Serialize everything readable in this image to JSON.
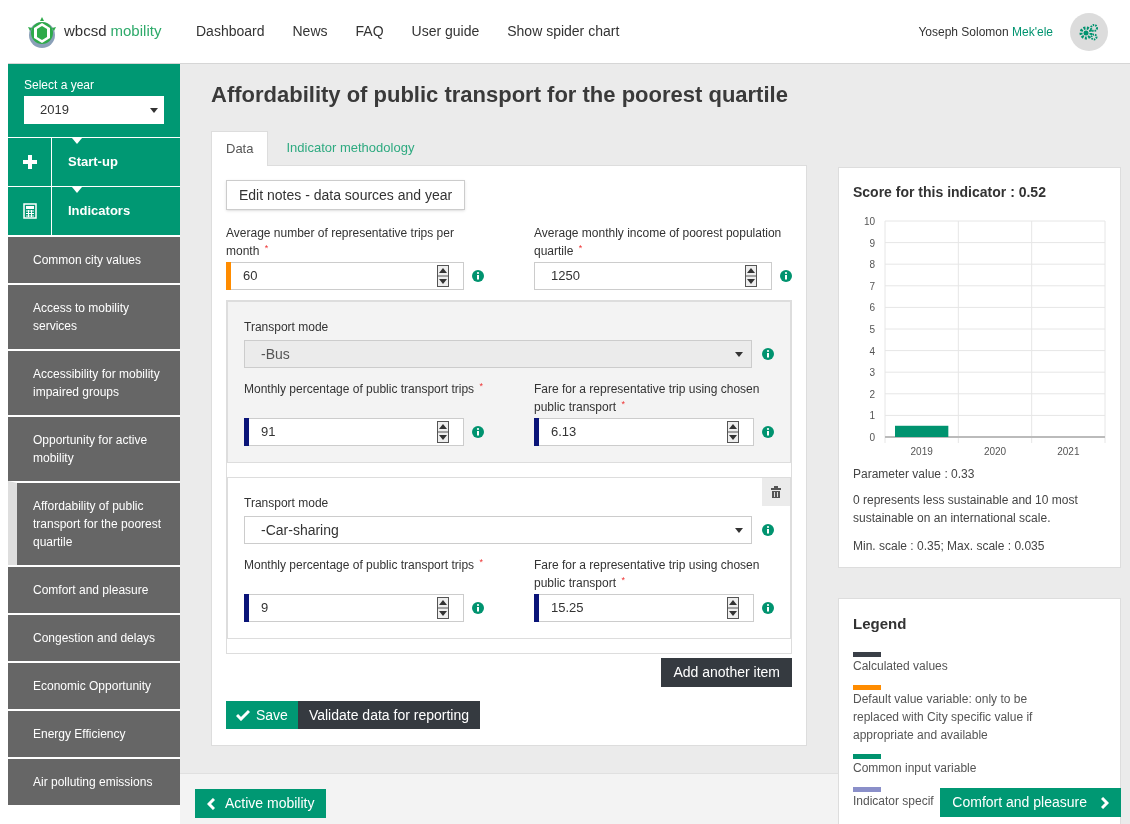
{
  "header": {
    "logo": {
      "brand": "wbcsd",
      "product": "mobility"
    },
    "nav": [
      {
        "label": "Dashboard"
      },
      {
        "label": "News"
      },
      {
        "label": "FAQ"
      },
      {
        "label": "User guide"
      },
      {
        "label": "Show spider chart"
      }
    ],
    "user": {
      "name": "Yoseph Solomon",
      "city": "Mek'ele"
    }
  },
  "sidebar": {
    "year_label": "Select a year",
    "year": "2019",
    "sections": [
      {
        "kind": "plus",
        "label": "Start-up"
      },
      {
        "kind": "calculator",
        "label": "Indicators"
      }
    ],
    "items": [
      {
        "label": "Common city values",
        "selected": false
      },
      {
        "label": "Access to mobility services",
        "selected": false
      },
      {
        "label": "Accessibility for mobility impaired groups",
        "selected": false
      },
      {
        "label": "Opportunity for active mobility",
        "selected": false
      },
      {
        "label": "Affordability of public transport for the poorest quartile",
        "selected": true
      },
      {
        "label": "Comfort and pleasure",
        "selected": false
      },
      {
        "label": "Congestion and delays",
        "selected": false
      },
      {
        "label": "Economic Opportunity",
        "selected": false
      },
      {
        "label": "Energy Efficiency",
        "selected": false
      },
      {
        "label": "Air polluting emissions",
        "selected": false
      }
    ]
  },
  "page_title": "Affordability of public transport for the poorest quartile",
  "tabs": [
    {
      "label": "Data",
      "selected": true
    },
    {
      "label": "Indicator methodology",
      "selected": false
    }
  ],
  "edit_notes_button": "Edit notes - data sources and year",
  "fields": [
    {
      "label": "Average number of representative trips per month",
      "required_mark": "*",
      "value": "60",
      "color": "#ff8c00"
    },
    {
      "label": "Average monthly income of poorest population quartile",
      "required_mark": "*",
      "value": "1250"
    }
  ],
  "transport_items": [
    {
      "mode_label": "Transport mode",
      "mode": "-Bus",
      "disabled": true,
      "removable": false,
      "fields": [
        {
          "label": "Monthly percentage of public transport trips",
          "required_mark": "*",
          "value": "91",
          "color": "#0a1478"
        },
        {
          "label": "Fare for a representative trip using chosen public transport",
          "required_mark": "*",
          "value": "6.13",
          "color": "#0a1478"
        }
      ]
    },
    {
      "mode_label": "Transport mode",
      "mode": "-Car-sharing",
      "disabled": false,
      "removable": true,
      "fields": [
        {
          "label": "Monthly percentage of public transport trips",
          "required_mark": "*",
          "value": "9",
          "color": "#0a1478"
        },
        {
          "label": "Fare for a representative trip using chosen public transport",
          "required_mark": "*",
          "value": "15.25",
          "color": "#0a1478"
        }
      ]
    }
  ],
  "add_button": "Add another item",
  "save_button": "Save",
  "validate_button": "Validate data for reporting",
  "score_card": {
    "title": "Score for this indicator : 0.52",
    "chart_data": {
      "type": "bar",
      "categories": [
        "2019",
        "2020",
        "2021"
      ],
      "series": [
        {
          "color": "#00936f",
          "values": [
            0.52,
            null,
            null
          ]
        }
      ],
      "grid": true,
      "ylim": [
        0,
        10
      ],
      "yticks": [
        0,
        1,
        2,
        3,
        4,
        5,
        6,
        7,
        8,
        9,
        10
      ]
    },
    "parameter": "Parameter value : 0.33",
    "note": "0 represents less sustainable and 10 most sustainable on an international scale.",
    "scale": "Min. scale : 0.35; Max. scale : 0.035"
  },
  "legend": {
    "title": "Legend",
    "items": [
      {
        "color": "#3a3f47",
        "label": "Calculated values"
      },
      {
        "color": "#ff8c00",
        "label": "Default value variable: only to be replaced with City specific value if appropriate and available"
      },
      {
        "color": "#00936f",
        "label": "Common input variable"
      },
      {
        "color": "#8a8fc9",
        "label": "Indicator specif"
      }
    ]
  },
  "footer": {
    "prev": "Active mobility",
    "next": "Comfort and pleasure"
  }
}
